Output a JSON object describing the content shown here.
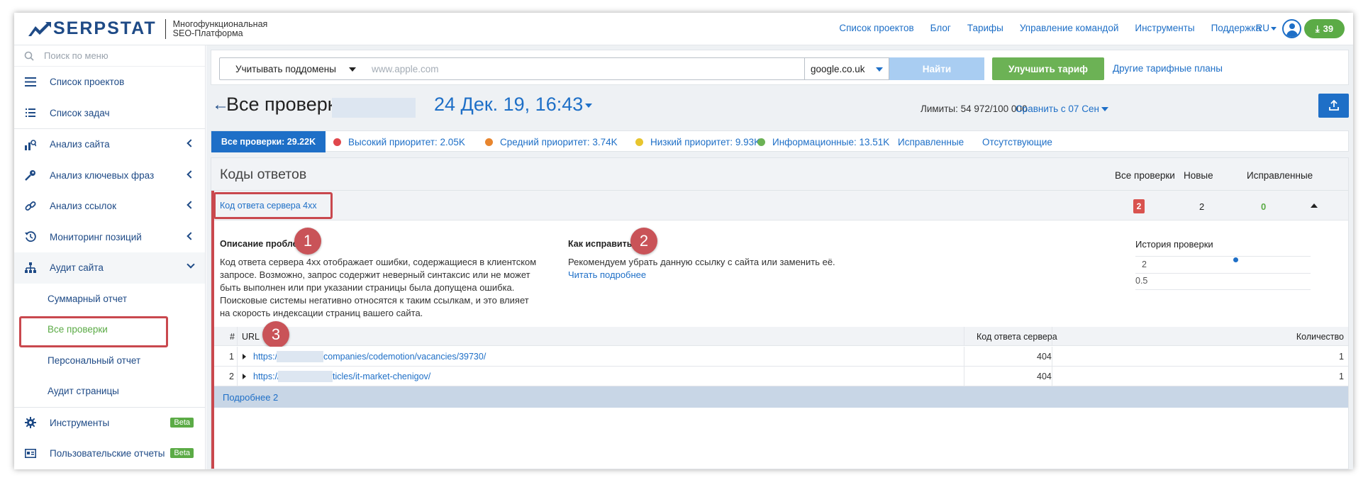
{
  "brand": {
    "name": "SERPSTAT",
    "tagline_line1": "Многофункциональная",
    "tagline_line2": "SEO-Платформа"
  },
  "topnav": {
    "links": [
      "Список проектов",
      "Блог",
      "Тарифы",
      "Управление командой",
      "Инструменты",
      "Поддержка"
    ],
    "lang": "RU",
    "downloads_count": "39"
  },
  "sidebar": {
    "search_placeholder": "Поиск по меню",
    "items": [
      {
        "label": "Список проектов",
        "icon": "list-icon"
      },
      {
        "label": "Список задач",
        "icon": "tasks-icon"
      },
      {
        "label": "Анализ сайта",
        "icon": "site-analysis-icon"
      },
      {
        "label": "Анализ ключевых фраз",
        "icon": "key-icon"
      },
      {
        "label": "Анализ ссылок",
        "icon": "link-icon"
      },
      {
        "label": "Мониторинг позиций",
        "icon": "history-icon"
      },
      {
        "label": "Аудит сайта",
        "icon": "sitemap-icon"
      }
    ],
    "audit_subitems": [
      "Суммарный отчет",
      "Все проверки",
      "Персональный отчет",
      "Аудит страницы"
    ],
    "tools_label": "Инструменты",
    "reports_label": "Пользовательские отчеты",
    "beta_label": "Beta"
  },
  "searchbar": {
    "subdomains_label": "Учитывать поддомены",
    "domain_placeholder": "www.apple.com",
    "engine_value": "google.co.uk",
    "find_label": "Найти",
    "upgrade_label": "Улучшить тариф",
    "other_plans_label": "Другие тарифные планы"
  },
  "header": {
    "title": "Все проверки",
    "date": "24 Дек. 19, 16:43",
    "limits": "Лимиты: 54 972/100 000",
    "compare_label": "Сравнить с",
    "compare_date": "07 Сен"
  },
  "filters": {
    "all": "Все проверки: 29.22K",
    "high": "Высокий приоритет: 2.05K",
    "medium": "Средний приоритет: 3.74K",
    "low": "Низкий приоритет: 9.93K",
    "info": "Информационные: 13.51K",
    "fixed": "Исправленные",
    "missing": "Отсутствующие",
    "colors": {
      "high": "#e0474c",
      "medium": "#e8852e",
      "low": "#e8c52e",
      "info": "#6cb255"
    }
  },
  "panel": {
    "title": "Коды ответов",
    "col_all": "Все проверки",
    "col_new": "Новые",
    "col_fixed": "Исправленные",
    "issue": {
      "name": "Код ответа сервера 4xx",
      "all": "2",
      "new": "2",
      "fixed": "0"
    },
    "problem_head": "Описание проблемы",
    "problem_text": "Код ответа сервера 4xx отображает ошибки, содержащиеся в клиентском запросе. Возможно, запрос содержит неверный синтаксис или не может быть выполнен или при указании страницы была допущена ошибка. Поисковые системы негативно относятся к таким ссылкам, и это влияет на скорость индексации страниц вашего сайта.",
    "fix_head": "Как исправить?",
    "fix_text": "Рекомендуем убрать данную ссылку с сайта или заменить её.",
    "fix_more": "Читать подробнее",
    "history_head": "История проверки",
    "history_ticks": [
      "2",
      "0.5"
    ],
    "callouts": [
      "1",
      "2",
      "3"
    ]
  },
  "table": {
    "headers": {
      "num": "#",
      "url": "URL",
      "code": "Код ответа сервера",
      "qty": "Количество"
    },
    "rows": [
      {
        "num": "1",
        "url_prefix": "https:/",
        "url_suffix": "companies/codemotion/vacancies/39730/",
        "code": "404",
        "qty": "1"
      },
      {
        "num": "2",
        "url_prefix": "https://",
        "url_suffix": "ticles/it-market-chenigov/",
        "code": "404",
        "qty": "1"
      }
    ],
    "more": "Подробнее 2"
  }
}
